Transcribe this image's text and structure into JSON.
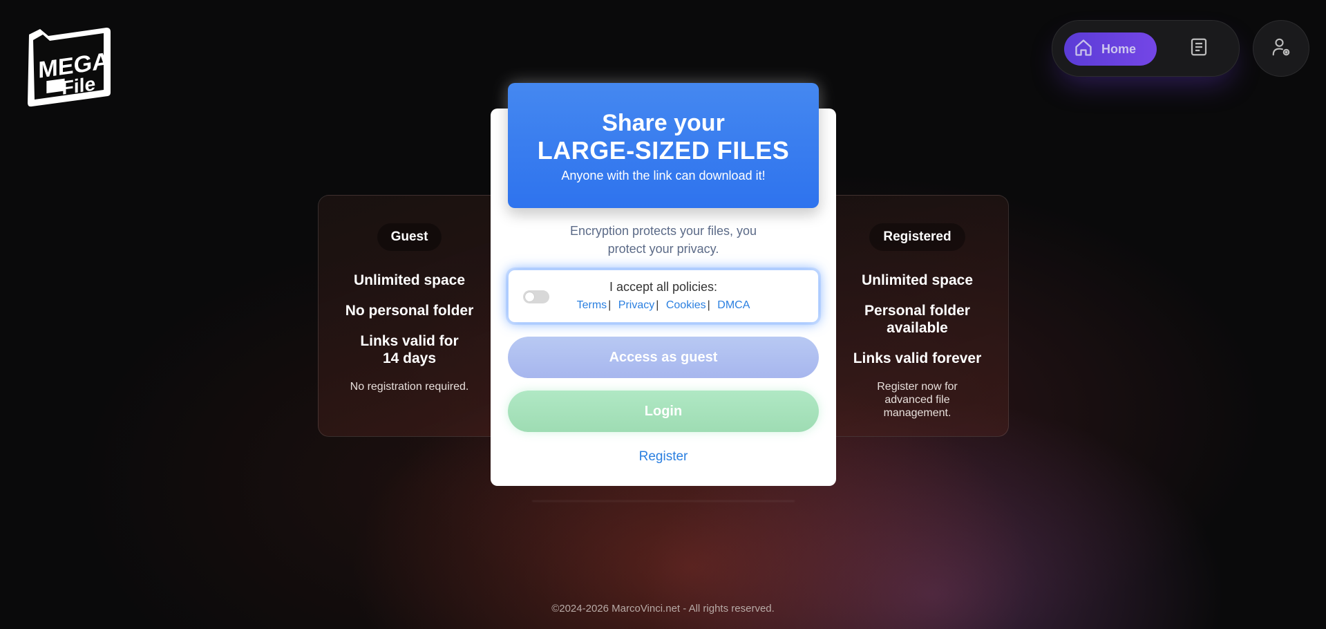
{
  "logo": {
    "top_text": "MEGA",
    "bottom_text": "File"
  },
  "nav": {
    "home_label": "Home",
    "items": [
      {
        "icon": "home-icon",
        "label": "Home",
        "active": true
      },
      {
        "icon": "document-icon"
      }
    ],
    "user_icon": "user-settings-icon"
  },
  "guest_card": {
    "badge": "Guest",
    "features": [
      "Unlimited space",
      "No personal folder",
      "Links valid for 14 days"
    ],
    "note": "No registration required."
  },
  "registered_card": {
    "badge": "Registered",
    "features": [
      "Unlimited space",
      "Personal folder available",
      "Links valid forever"
    ],
    "note": "Register now for advanced file management."
  },
  "hero": {
    "line1": "Share your",
    "line2": "LARGE-SIZED FILES",
    "subtitle": "Anyone with the link can download it!"
  },
  "tagline": "Encryption protects your files, you protect your privacy.",
  "policies": {
    "label": "I accept all policies:",
    "accepted": false,
    "links": [
      "Terms",
      "Privacy",
      "Cookies",
      "DMCA"
    ]
  },
  "buttons": {
    "guest": "Access as guest",
    "login": "Login",
    "register": "Register"
  },
  "footer": "©2024-2026 MarcoVinci.net - All rights reserved.",
  "colors": {
    "hero_blue": "#3b82f6",
    "guest_button": "#aebdf0",
    "login_button": "#a6e1ba",
    "link_blue": "#2a7fe0",
    "nav_active": "#6a42e0"
  }
}
